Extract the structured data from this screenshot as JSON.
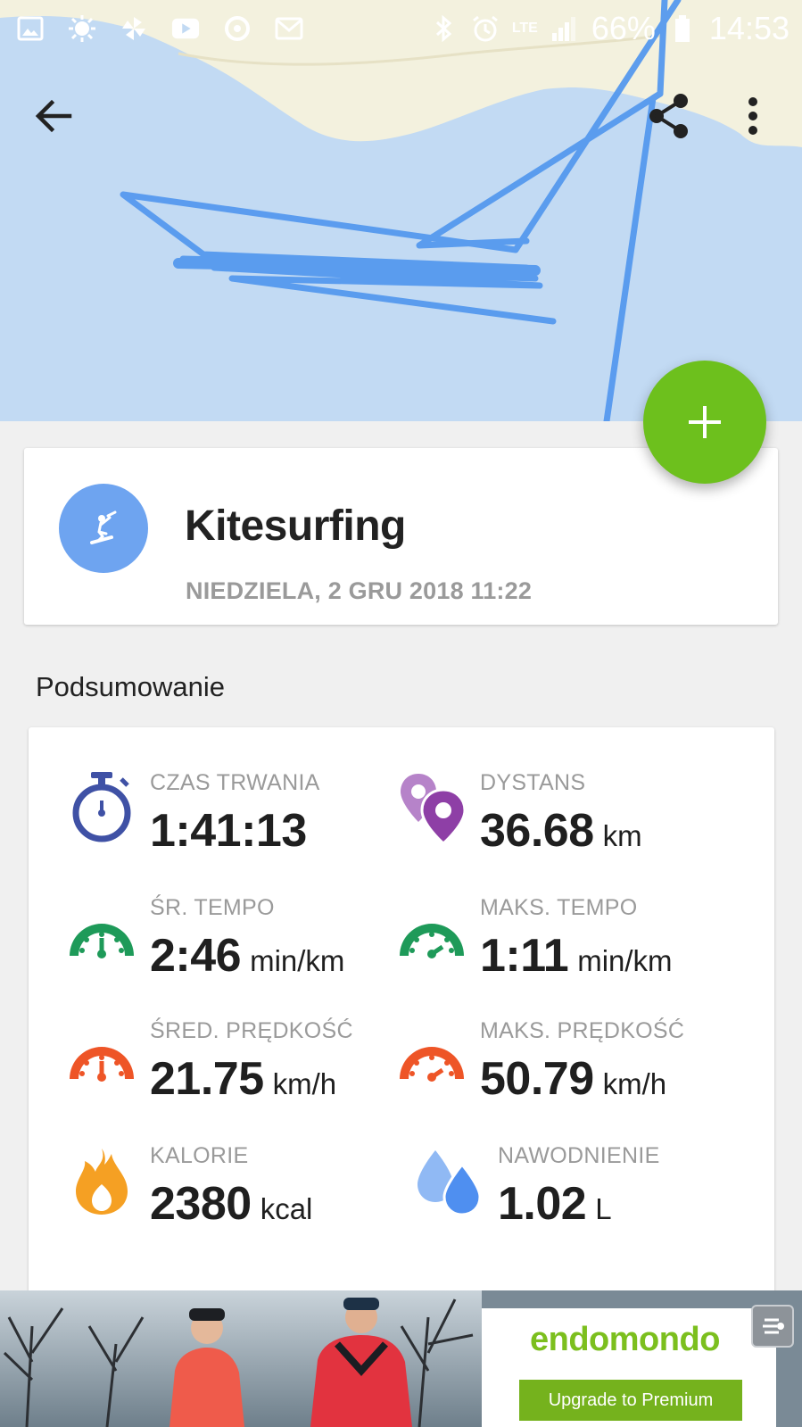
{
  "status_bar": {
    "icons_left": [
      "gallery-icon",
      "sun-icon",
      "pinwheel-icon",
      "youtube-icon",
      "sync-icon",
      "gmail-icon"
    ],
    "icons_right": [
      "bluetooth-icon",
      "alarm-icon",
      "signal-icon",
      "battery-icon"
    ],
    "network": "LTE",
    "battery": "66%",
    "time": "14:53"
  },
  "app_bar": {
    "back_icon": "arrow-back-icon",
    "share_icon": "share-icon",
    "more_icon": "more-vert-icon"
  },
  "fab": {
    "icon": "plus-icon",
    "color": "#6dc01d"
  },
  "workout": {
    "sport": "Kitesurfing",
    "date": "NIEDZIELA, 2 GRU 2018 11:22",
    "avatar_color": "#6ea4f0"
  },
  "summary": {
    "title": "Podsumowanie",
    "stats": [
      {
        "label": "CZAS TRWANIA",
        "value": "1:41:13",
        "unit": "",
        "icon": "stopwatch-icon",
        "color": "#3f51a5"
      },
      {
        "label": "DYSTANS",
        "value": "36.68",
        "unit": "km",
        "icon": "location-pins-icon",
        "color": "#8e3fa6"
      },
      {
        "label": "ŚR. TEMPO",
        "value": "2:46",
        "unit": "min/km",
        "icon": "speedometer-icon",
        "color": "#1e9a59"
      },
      {
        "label": "MAKS. TEMPO",
        "value": "1:11",
        "unit": "min/km",
        "icon": "speedometer-icon",
        "color": "#1e9a59"
      },
      {
        "label": "ŚRED. PRĘDKOŚĆ",
        "value": "21.75",
        "unit": "km/h",
        "icon": "speedometer-icon",
        "color": "#ee5527"
      },
      {
        "label": "MAKS. PRĘDKOŚĆ",
        "value": "50.79",
        "unit": "km/h",
        "icon": "speedometer-icon",
        "color": "#ee5527"
      },
      {
        "label": "KALORIE",
        "value": "2380",
        "unit": "kcal",
        "icon": "flame-icon",
        "color": "#f5a023"
      },
      {
        "label": "NAWODNIENIE",
        "value": "1.02",
        "unit": "L",
        "icon": "water-drops-icon",
        "color": "#4f8ff0"
      }
    ]
  },
  "ad": {
    "brand": "endomondo",
    "cta": "Upgrade to Premium",
    "brand_color": "#7cbf1e"
  }
}
